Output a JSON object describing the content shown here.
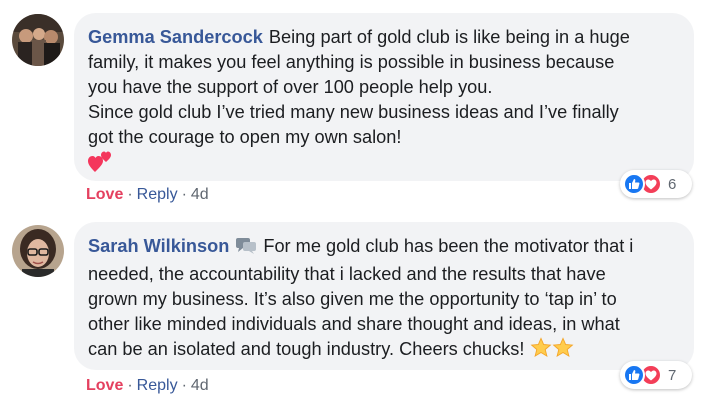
{
  "comments": [
    {
      "author": "Gemma Sandercock",
      "body_lines": [
        "Being part of gold club is like being in a huge",
        "family, it makes you feel anything is possible in business because",
        "you have the support of over 100 people help you.",
        "Since gold club I’ve tried many new business ideas and I’ve finally",
        "got the courage to open my own salon!"
      ],
      "emoji_after": "heart-icon",
      "action_love": "Love",
      "action_sep": "·",
      "action_reply": "Reply",
      "timestamp": "4d",
      "reaction_count": "6"
    },
    {
      "author": "Sarah Wilkinson",
      "body_lines": [
        "For me gold club has been the motivator that i",
        "needed, the accountability that i lacked and the results that have",
        "grown my business. It’s also given me the opportunity to ‘tap in’ to",
        "other like minded individuals and share thought and ideas, in what",
        "can be an isolated and tough industry. Cheers chucks!"
      ],
      "emoji_after": "star-icon",
      "action_love": "Love",
      "action_sep": "·",
      "action_reply": "Reply",
      "timestamp": "4d",
      "reaction_count": "7"
    }
  ],
  "colors": {
    "author": "#385898",
    "love": "#e4405f",
    "bubble": "#f2f3f5",
    "like": "#1877f2",
    "heart": "#f33e58"
  }
}
